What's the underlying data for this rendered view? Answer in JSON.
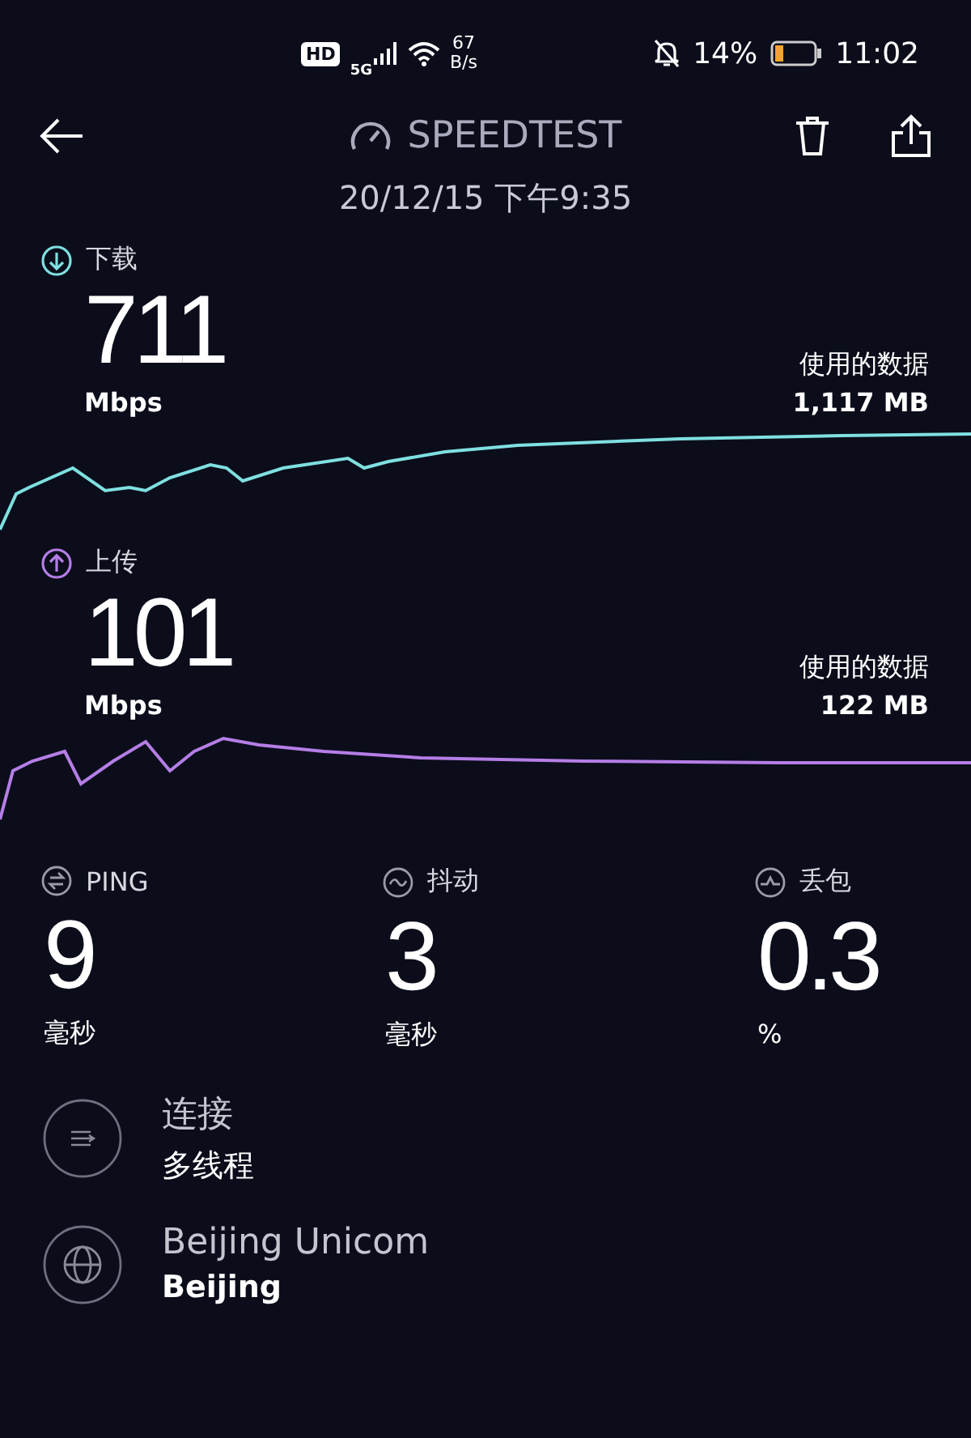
{
  "status_bar": {
    "hd": "HD",
    "network": "5G",
    "speed_value": "67",
    "speed_unit": "B/s",
    "battery": "14%",
    "time": "11:02"
  },
  "header": {
    "title": "SPEEDTEST",
    "date": "20/12/15 下午9:35"
  },
  "results": [
    {
      "kind": "download",
      "label": "下载",
      "value": "711",
      "unit": "Mbps",
      "data_label": "使用的数据",
      "data_value": "1,117 MB"
    },
    {
      "kind": "upload",
      "label": "上传",
      "value": "101",
      "unit": "Mbps",
      "data_label": "使用的数据",
      "data_value": "122 MB"
    }
  ],
  "metrics": [
    {
      "kind": "ping",
      "label": "PING",
      "value": "9",
      "unit": "毫秒"
    },
    {
      "kind": "jitter",
      "label": "抖动",
      "value": "3",
      "unit": "毫秒"
    },
    {
      "kind": "loss",
      "label": "丢包",
      "value": "0.3",
      "unit": "%"
    }
  ],
  "details": [
    {
      "kind": "connection",
      "title": "连接",
      "subtitle": "多线程"
    },
    {
      "kind": "server",
      "title": "Beijing Unicom",
      "subtitle": "Beijing"
    }
  ]
}
